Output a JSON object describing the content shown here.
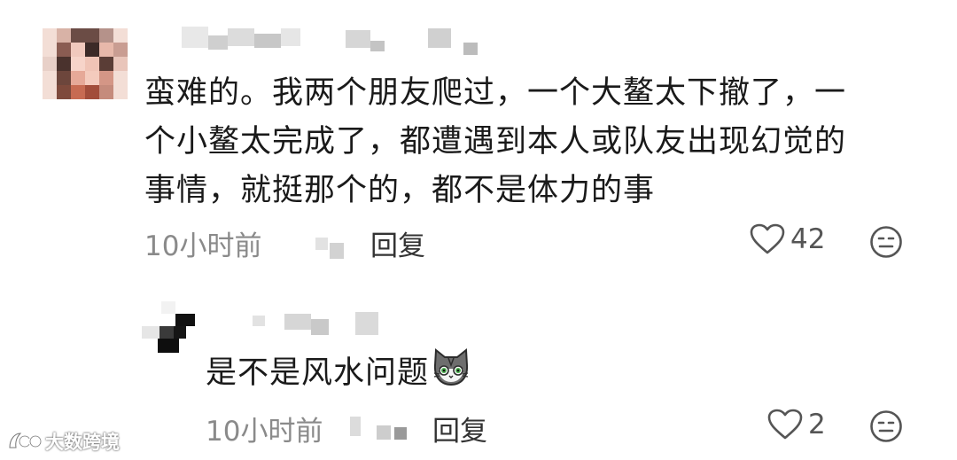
{
  "comments": [
    {
      "text_lines": [
        "蛮难的。我两个朋友爬过，一个大鳌太下撤了，一",
        "个小鳌太完成了，都遭遇到本人或队友出现幻觉的",
        "事情，就挺那个的，都不是体力的事"
      ],
      "time": "10小时前",
      "reply_label": "回复",
      "likes": "42",
      "like_icon": "heart-outline-icon",
      "more_icon": "emoji-menu-icon"
    },
    {
      "text": "是不是风水问题",
      "emoji": "cat-face-emoji",
      "time": "10小时前",
      "reply_label": "回复",
      "likes": "2",
      "like_icon": "heart-outline-icon",
      "more_icon": "emoji-menu-icon"
    }
  ],
  "watermark": {
    "text": "大数跨境"
  },
  "colors": {
    "text": "#1a1a1a",
    "meta": "#8a8a8a",
    "mosaic": "#cfcfcf"
  }
}
